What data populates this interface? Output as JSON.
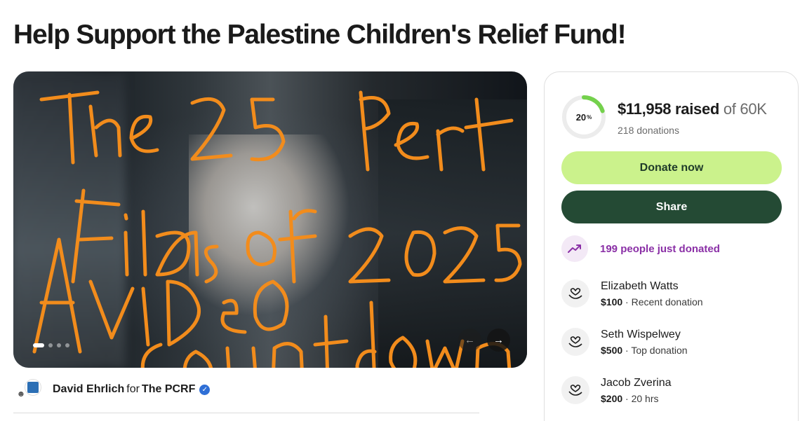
{
  "page": {
    "title": "Help Support the Palestine Children's Relief Fund!"
  },
  "hero": {
    "overlay_text_lines": [
      "The 25 best",
      "Films of 2025",
      "A VIDEO",
      "Countdown"
    ],
    "carousel_dots": 4,
    "carousel_active_index": 0,
    "prev_icon": "arrow-left-icon",
    "next_icon": "arrow-right-icon",
    "prev_glyph": "←",
    "next_glyph": "→"
  },
  "organizer": {
    "name": "David Ehrlich",
    "for_label": "for",
    "beneficiary": "The PCRF",
    "verified_glyph": "✓"
  },
  "summary": {
    "percent_label": "20",
    "percent_sign": "%",
    "progress_fraction": 0.2,
    "raised_amount": "$11,958 raised",
    "goal_text": "of 60K",
    "donations_count": "218 donations"
  },
  "buttons": {
    "donate_label": "Donate now",
    "share_label": "Share"
  },
  "activity": {
    "trend_text": "199 people just donated"
  },
  "donors": [
    {
      "name": "Elizabeth Watts",
      "amount": "$100",
      "note": " · Recent donation"
    },
    {
      "name": "Seth Wispelwey",
      "amount": "$500",
      "note": " · Top donation"
    },
    {
      "name": "Jacob Zverina",
      "amount": "$200",
      "note": " · 20 hrs"
    }
  ],
  "colors": {
    "donate_button": "#cbf28c",
    "share_button": "#244a34",
    "progress_ring": "#74d14c",
    "trend_text": "#8a2fa6",
    "scribble": "#f28c1c"
  }
}
